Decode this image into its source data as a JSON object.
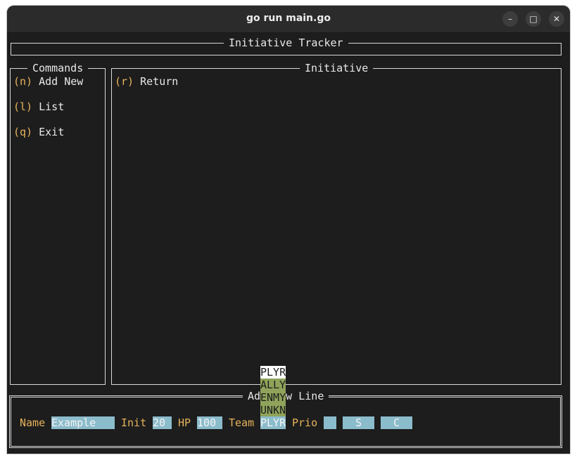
{
  "window": {
    "title": "go run main.go",
    "minimize_icon": "–",
    "maximize_icon": "□",
    "close_icon": "✕"
  },
  "header": {
    "title": "Initiative Tracker"
  },
  "commands": {
    "title": "Commands",
    "items": [
      {
        "key": "(n)",
        "label": "Add New"
      },
      {
        "key": "(l)",
        "label": "List"
      },
      {
        "key": "(q)",
        "label": "Exit"
      }
    ]
  },
  "initiative": {
    "title": "Initiative",
    "items": [
      {
        "key": "(r)",
        "label": "Return"
      }
    ]
  },
  "form": {
    "title": "Add New Line",
    "name_label": "Name",
    "name_value": "Example",
    "init_label": "Init",
    "init_value": "20",
    "hp_label": "HP",
    "hp_value": "100",
    "team_label": "Team",
    "team_value": "PLYR",
    "prio_label": "Prio",
    "prio_value": "",
    "save_label": "S",
    "cancel_label": "C"
  },
  "team_dropdown": {
    "options": [
      "PLYR",
      "ALLY",
      "ENMY",
      "UNKN"
    ],
    "selected": "PLYR"
  },
  "colors": {
    "terminal_bg": "#1d1d1d",
    "key_accent": "#e8b35c",
    "field_bg": "#8bbccc",
    "option_bg": "#8fa35a"
  }
}
